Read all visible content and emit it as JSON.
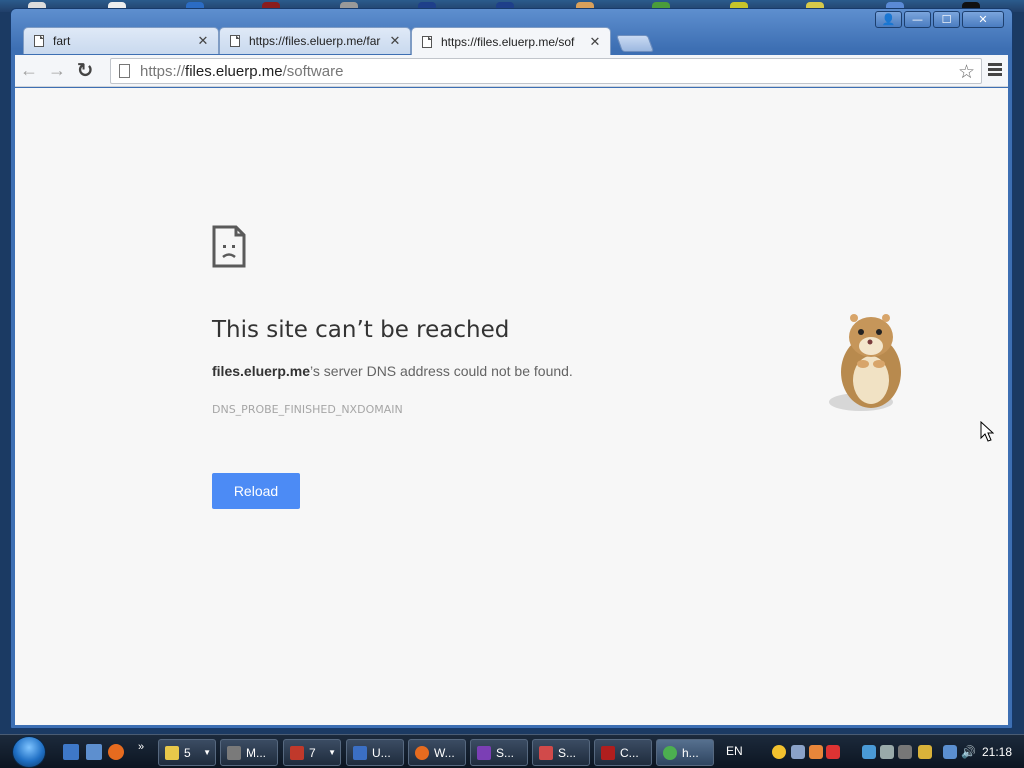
{
  "tabs": [
    {
      "label": "fart",
      "close": "✕"
    },
    {
      "label": "https://files.eluerp.me/far",
      "close": "✕"
    },
    {
      "label": "https://files.eluerp.me/sof",
      "close": "✕",
      "active": true
    }
  ],
  "window_controls": {
    "user": "👤",
    "minimize": "—",
    "maximize": "☐",
    "close": "✕"
  },
  "toolbar": {
    "back": "←",
    "forward": "→",
    "reload": "↻",
    "url_scheme": "https://",
    "url_host": "files.eluerp.me",
    "url_path": "/software",
    "star": "☆"
  },
  "error": {
    "title": "This site can’t be reached",
    "host": "files.eluerp.me",
    "desc_rest": "’s server DNS address could not be found.",
    "code": "DNS_PROBE_FINISHED_NXDOMAIN",
    "reload_label": "Reload"
  },
  "taskbar": {
    "buttons": [
      {
        "label": "5",
        "color": "#e8c84a",
        "group": true
      },
      {
        "label": "M...",
        "color": "#7a7a7a"
      },
      {
        "label": "7",
        "color": "#c0392b",
        "group": true
      },
      {
        "label": "U...",
        "color": "#3b6fc4"
      },
      {
        "label": "W...",
        "color": "#e66b1f"
      },
      {
        "label": "S...",
        "color": "#7b3fb5"
      },
      {
        "label": "S...",
        "color": "#d14a4a"
      },
      {
        "label": "C...",
        "color": "#b01e1e"
      },
      {
        "label": "h...",
        "color": "#4caf50"
      }
    ],
    "lang": "EN",
    "clock": "21:18"
  },
  "colors": {
    "reload_button": "#4c8bf5",
    "page_background": "#f7f7f7"
  }
}
